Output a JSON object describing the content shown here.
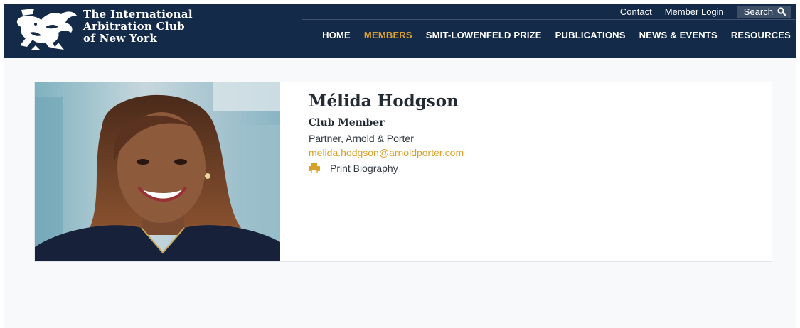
{
  "header": {
    "logo_lines": [
      "The International",
      "Arbitration Club",
      "of New York"
    ],
    "utility": {
      "contact": "Contact",
      "member_login": "Member Login",
      "search": "Search"
    },
    "nav": [
      "HOME",
      "MEMBERS",
      "SMIT-LOWENFELD PRIZE",
      "PUBLICATIONS",
      "NEWS & EVENTS",
      "RESOURCES"
    ],
    "active_nav": "MEMBERS"
  },
  "profile": {
    "name": "Mélida Hodgson",
    "role": "Club Member",
    "firm": "Partner, Arnold & Porter",
    "email": "melida.hodgson@arnoldporter.com",
    "print_label": "Print Biography"
  },
  "colors": {
    "header_bg": "#142a49",
    "accent": "#d9a02a",
    "page_bg": "#f8f9fb"
  },
  "icons": [
    "griffin-logo-icon",
    "search-icon",
    "printer-icon"
  ]
}
